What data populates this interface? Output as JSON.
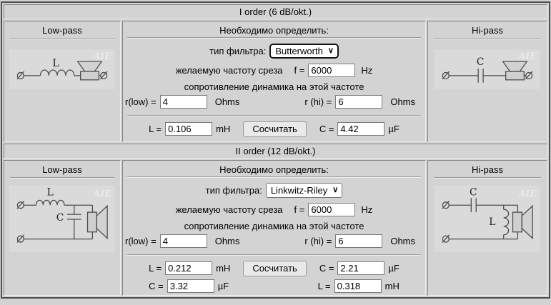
{
  "page": {
    "background": "#d3d3d3"
  },
  "blocks": [
    {
      "header": "I order (6 dB/okt.)",
      "low_pass": {
        "title": "Low-pass",
        "component_label": "L",
        "watermark": "AIE"
      },
      "hi_pass": {
        "title": "Hi-pass",
        "component_label": "C",
        "watermark": "AIE"
      },
      "middle": {
        "title": "Необходимо определить:",
        "filter_type_label": "тип фильтра:",
        "filter_type_value": "Butterworth",
        "freq_label": "желаемую частоту среза",
        "f_label": "f =",
        "f_value": "6000",
        "f_unit": "Hz",
        "impedance_label": "сопротивление динамика на этой частоте",
        "r_low_label": "r(low) =",
        "r_low_value": "4",
        "r_low_unit": "Ohms",
        "r_hi_label": "r (hi) =",
        "r_hi_value": "6",
        "r_hi_unit": "Ohms",
        "calc_button": "Сосчитать",
        "results": [
          {
            "left_label": "L =",
            "left_value": "0.106",
            "left_unit": "mH",
            "right_label": "C =",
            "right_value": "4.42",
            "right_unit": "µF"
          }
        ]
      }
    },
    {
      "header": "II order (12 dB/okt.)",
      "low_pass": {
        "title": "Low-pass",
        "series_label": "L",
        "shunt_label": "C",
        "watermark": "AIE"
      },
      "hi_pass": {
        "title": "Hi-pass",
        "series_label": "C",
        "shunt_label": "L",
        "watermark": "AIE"
      },
      "middle": {
        "title": "Необходимо определить:",
        "filter_type_label": "тип фильтра:",
        "filter_type_value": "Linkwitz-Riley",
        "freq_label": "желаемую частоту среза",
        "f_label": "f =",
        "f_value": "6000",
        "f_unit": "Hz",
        "impedance_label": "сопротивление динамика на этой частоте",
        "r_low_label": "r(low) =",
        "r_low_value": "4",
        "r_low_unit": "Ohms",
        "r_hi_label": "r (hi) =",
        "r_hi_value": "6",
        "r_hi_unit": "Ohms",
        "calc_button": "Сосчитать",
        "results": [
          {
            "left_label": "L =",
            "left_value": "0.212",
            "left_unit": "mH",
            "right_label": "C =",
            "right_value": "2.21",
            "right_unit": "µF"
          },
          {
            "left_label": "C =",
            "left_value": "3.32",
            "left_unit": "µF",
            "right_label": "L =",
            "right_value": "0.318",
            "right_unit": "mH"
          }
        ]
      }
    }
  ]
}
